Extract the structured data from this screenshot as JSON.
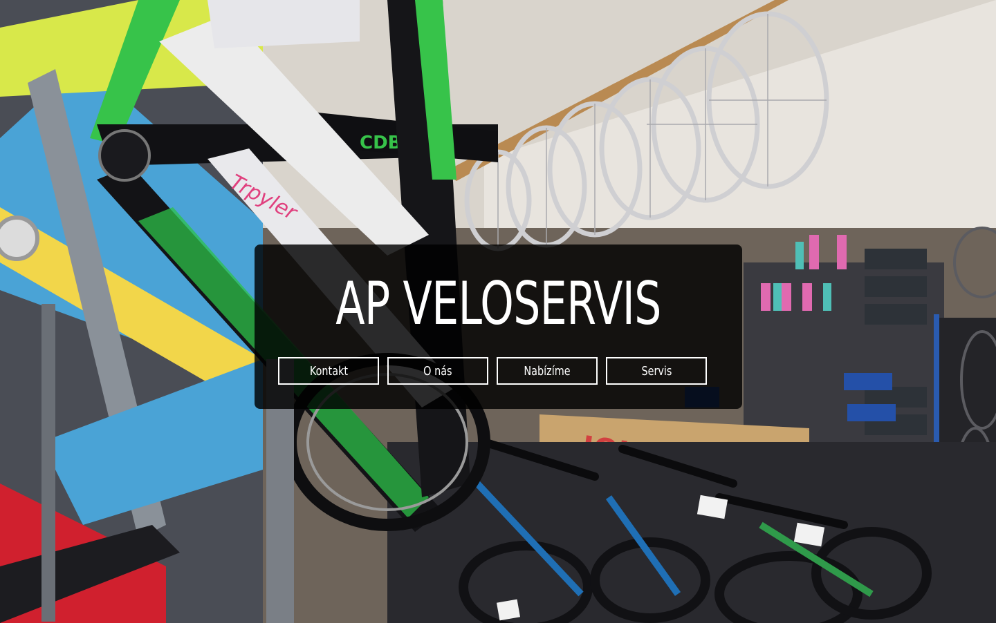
{
  "hero": {
    "title": "AP VELOSERVIS",
    "background_description": "bicycle-shop-photo",
    "overlay_color": "#000000"
  },
  "nav": {
    "items": [
      {
        "label": "Kontakt"
      },
      {
        "label": "O nás"
      },
      {
        "label": "Nabízíme"
      },
      {
        "label": "Servis"
      }
    ]
  },
  "colors": {
    "text": "#ffffff",
    "button_border": "#ffffff"
  }
}
